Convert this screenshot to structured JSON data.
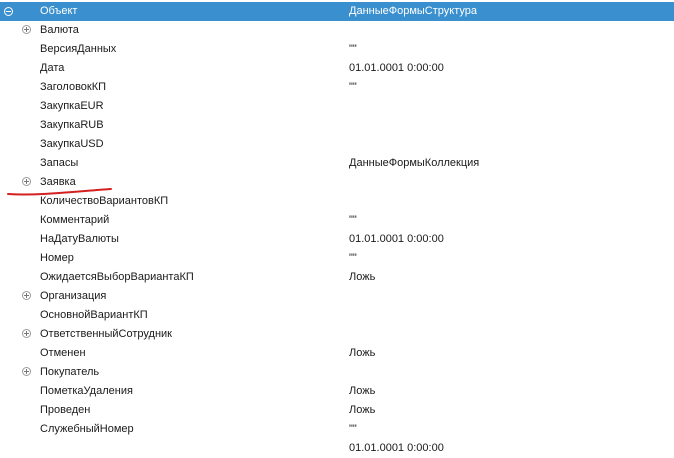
{
  "root": {
    "name": "Объект",
    "value": "ДанныеФормыСтруктура"
  },
  "rows": [
    {
      "name": "Валюта",
      "value": "",
      "expandable": true
    },
    {
      "name": "ВерсияДанных",
      "value": "\"\"",
      "expandable": false
    },
    {
      "name": "Дата",
      "value": "01.01.0001 0:00:00",
      "expandable": false
    },
    {
      "name": "ЗаголовокКП",
      "value": "\"\"",
      "expandable": false
    },
    {
      "name": "ЗакупкаEUR",
      "value": "",
      "expandable": false
    },
    {
      "name": "ЗакупкаRUB",
      "value": "",
      "expandable": false
    },
    {
      "name": "ЗакупкаUSD",
      "value": "",
      "expandable": false
    },
    {
      "name": "Запасы",
      "value": "ДанныеФормыКоллекция",
      "expandable": false
    },
    {
      "name": "Заявка",
      "value": "",
      "expandable": true
    },
    {
      "name": "КоличествоВариантовКП",
      "value": "",
      "expandable": false
    },
    {
      "name": "Комментарий",
      "value": "\"\"",
      "expandable": false
    },
    {
      "name": "НаДатуВалюты",
      "value": "01.01.0001 0:00:00",
      "expandable": false
    },
    {
      "name": "Номер",
      "value": "\"\"",
      "expandable": false
    },
    {
      "name": "ОжидаетсяВыборВариантаКП",
      "value": "Ложь",
      "expandable": false
    },
    {
      "name": "Организация",
      "value": "",
      "expandable": true
    },
    {
      "name": "ОсновнойВариантКП",
      "value": "",
      "expandable": false
    },
    {
      "name": "ОтветственныйСотрудник",
      "value": "",
      "expandable": true
    },
    {
      "name": "Отменен",
      "value": "Ложь",
      "expandable": false
    },
    {
      "name": "Покупатель",
      "value": "",
      "expandable": true
    },
    {
      "name": "ПометкаУдаления",
      "value": "Ложь",
      "expandable": false
    },
    {
      "name": "Проведен",
      "value": "Ложь",
      "expandable": false
    },
    {
      "name": "СлужебныйНомер",
      "value": "\"\"",
      "expandable": false
    },
    {
      "name": "",
      "value": "01.01.0001 0:00:00",
      "expandable": false
    }
  ],
  "colors": {
    "header_bg": "#3a8fcf",
    "annotation": "#d42020"
  }
}
